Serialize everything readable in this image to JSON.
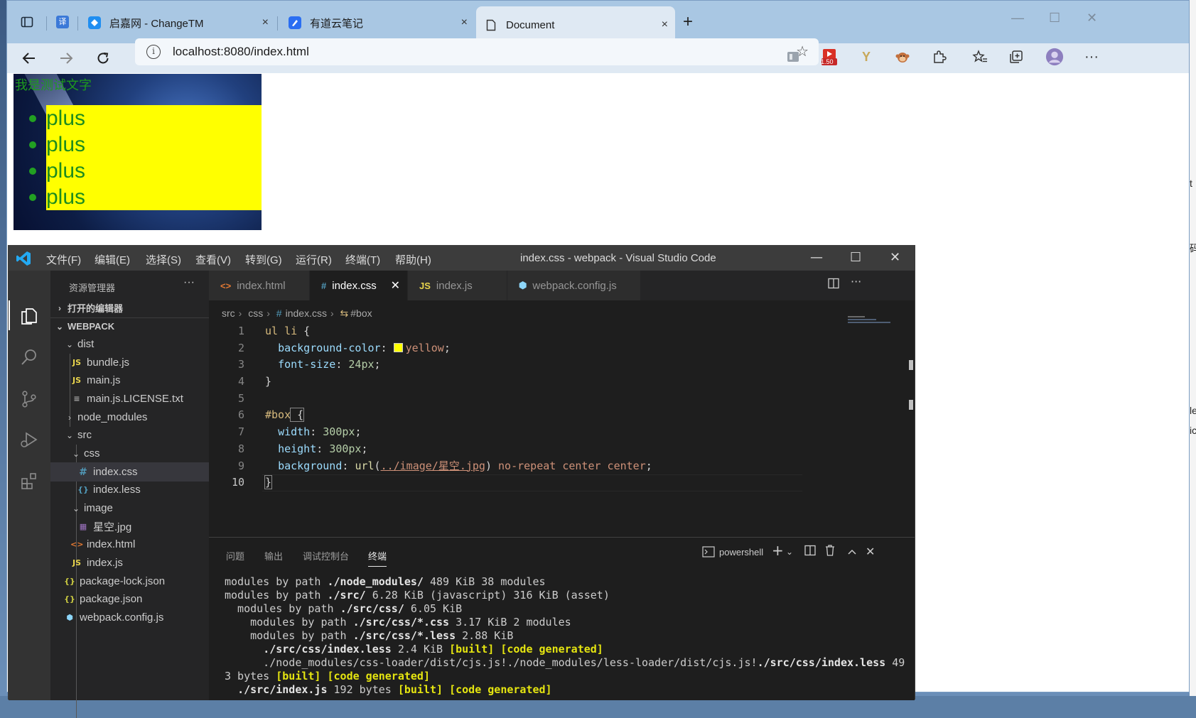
{
  "browser": {
    "tabs": [
      {
        "title": "启嘉网 - ChangeTM",
        "close": "×"
      },
      {
        "title": "有道云笔记",
        "close": "×"
      },
      {
        "title": "Document",
        "close": "×"
      }
    ],
    "translate_icon": "译",
    "new_tab": "+",
    "url": "localhost:8080/index.html",
    "ext_badge": "1.50"
  },
  "page": {
    "box_text": "我是测试文字",
    "list_items": [
      "plus",
      "plus",
      "plus",
      "plus"
    ],
    "right_edge_chars": [
      "t",
      "码",
      "le",
      "ic"
    ]
  },
  "vscode": {
    "menu": [
      "文件(F)",
      "编辑(E)",
      "选择(S)",
      "查看(V)",
      "转到(G)",
      "运行(R)",
      "终端(T)",
      "帮助(H)"
    ],
    "window_title": "index.css - webpack - Visual Studio Code",
    "explorer_title": "资源管理器",
    "open_editors": "打开的编辑器",
    "project": "WEBPACK",
    "tree": [
      {
        "label": "dist",
        "type": "folder-open"
      },
      {
        "label": "bundle.js",
        "type": "js"
      },
      {
        "label": "main.js",
        "type": "js"
      },
      {
        "label": "main.js.LICENSE.txt",
        "type": "txt"
      },
      {
        "label": "node_modules",
        "type": "folder-closed"
      },
      {
        "label": "src",
        "type": "folder-open"
      },
      {
        "label": "css",
        "type": "folder-open"
      },
      {
        "label": "index.css",
        "type": "css"
      },
      {
        "label": "index.less",
        "type": "less"
      },
      {
        "label": "image",
        "type": "folder-open"
      },
      {
        "label": "星空.jpg",
        "type": "img"
      },
      {
        "label": "index.html",
        "type": "html"
      },
      {
        "label": "index.js",
        "type": "js"
      },
      {
        "label": "package-lock.json",
        "type": "json"
      },
      {
        "label": "package.json",
        "type": "json"
      },
      {
        "label": "webpack.config.js",
        "type": "wp"
      }
    ],
    "editor_tabs": [
      "index.html",
      "index.css",
      "index.js",
      "webpack.config.js"
    ],
    "breadcrumb": [
      "src",
      "css",
      "index.css",
      "#box"
    ],
    "code": {
      "line_numbers": [
        "1",
        "2",
        "3",
        "4",
        "5",
        "6",
        "7",
        "8",
        "9",
        "10"
      ],
      "l1_sel": "ul li",
      "l1_brace": " {",
      "l2_prop": "background-color",
      "l2_colon": ": ",
      "l2_val": "yellow",
      "l2_end": ";",
      "l3_prop": "font-size",
      "l3_colon": ": ",
      "l3_val": "24px",
      "l3_end": ";",
      "l4": "}",
      "l6_sel": "#box",
      "l6_brace": " {",
      "l7_prop": "width",
      "l7_colon": ": ",
      "l7_val": "300px",
      "l7_end": ";",
      "l8_prop": "height",
      "l8_colon": ": ",
      "l8_val": "300px",
      "l8_end": ";",
      "l9_prop": "background",
      "l9_colon": ": ",
      "l9_fn": "url",
      "l9_open": "(",
      "l9_url": "../image/星空.jpg",
      "l9_close": ")",
      "l9_rest": " no-repeat center center",
      "l9_end": ";",
      "l10": "}"
    },
    "panel_tabs": [
      "问题",
      "输出",
      "调试控制台",
      "终端"
    ],
    "shell": "powershell",
    "terminal": {
      "l1a": "modules by path ",
      "l1b": "./node_modules/",
      "l1c": " 489 KiB 38 modules",
      "l2a": "modules by path ",
      "l2b": "./src/",
      "l2c": " 6.28 KiB (javascript) 316 KiB (asset)",
      "l3a": "  modules by path ",
      "l3b": "./src/css/",
      "l3c": " 6.05 KiB",
      "l4a": "    modules by path ",
      "l4b": "./src/css/*.css",
      "l4c": " 3.17 KiB 2 modules",
      "l5a": "    modules by path ",
      "l5b": "./src/css/*.less",
      "l5c": " 2.88 KiB",
      "l6a": "      ",
      "l6b": "./src/css/index.less",
      "l6c": " 2.4 KiB ",
      "l6d": "[built]",
      "l6e": " ",
      "l6f": "[code generated]",
      "l7a": "      ./node_modules/css-loader/dist/cjs.js!./node_modules/less-loader/dist/cjs.js!",
      "l7b": "./src/css/index.less",
      "l7c": " 49",
      "l8a": "3 bytes ",
      "l8b": "[built]",
      "l8c": " ",
      "l8d": "[code generated]",
      "l9a": "  ",
      "l9b": "./src/index.js",
      "l9c": " 192 bytes ",
      "l9d": "[built]",
      "l9e": " ",
      "l9f": "[code generated]"
    }
  }
}
